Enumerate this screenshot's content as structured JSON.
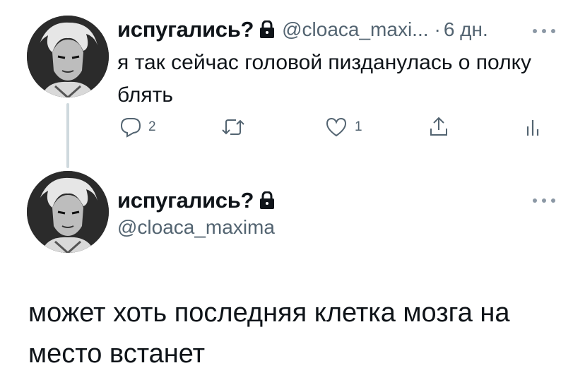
{
  "tweet1": {
    "display_name": "испугались?",
    "handle": "@cloaca_maxi...",
    "separator": "·",
    "time": "6 дн.",
    "text": "я так сейчас головой пизданулась о полку блять",
    "actions": {
      "reply_count": "2",
      "retweet_count": "",
      "like_count": "1"
    }
  },
  "tweet2": {
    "display_name": "испугались?",
    "handle": "@cloaca_maxima",
    "text": "может хоть последняя клетка мозга на место встанет"
  },
  "icons": {
    "lock": "lock-icon",
    "more": "more-dots-icon",
    "reply": "reply-icon",
    "retweet": "retweet-icon",
    "like": "heart-icon",
    "share": "share-icon",
    "analytics": "analytics-icon"
  },
  "colors": {
    "text_primary": "#0f1419",
    "text_secondary": "#536471",
    "thread_line": "#cfd9de"
  }
}
